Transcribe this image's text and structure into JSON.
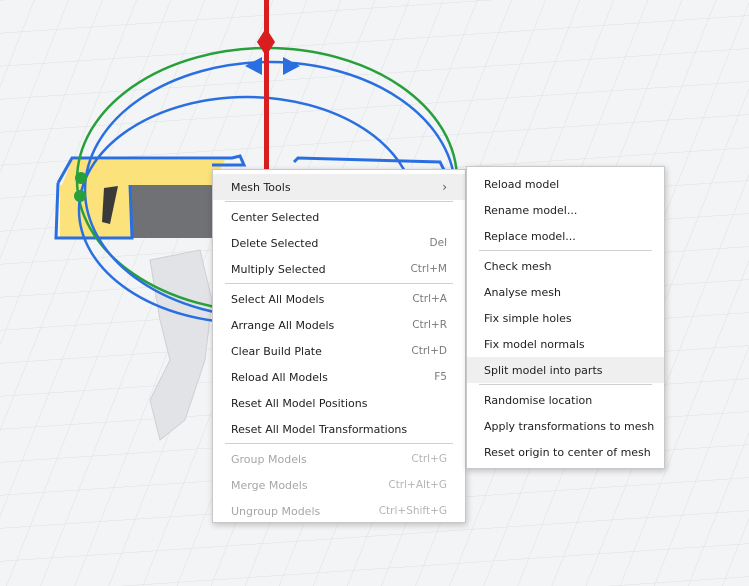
{
  "context_menu": {
    "groups": [
      [
        {
          "label": "Mesh Tools",
          "submenu": true,
          "hover": true
        }
      ],
      [
        {
          "label": "Center Selected",
          "shortcut": ""
        },
        {
          "label": "Delete Selected",
          "shortcut": "Del"
        },
        {
          "label": "Multiply Selected",
          "shortcut": "Ctrl+M"
        }
      ],
      [
        {
          "label": "Select All Models",
          "shortcut": "Ctrl+A"
        },
        {
          "label": "Arrange All Models",
          "shortcut": "Ctrl+R"
        },
        {
          "label": "Clear Build Plate",
          "shortcut": "Ctrl+D"
        },
        {
          "label": "Reload All Models",
          "shortcut": "F5"
        },
        {
          "label": "Reset All Model Positions",
          "shortcut": ""
        },
        {
          "label": "Reset All Model Transformations",
          "shortcut": ""
        }
      ],
      [
        {
          "label": "Group Models",
          "shortcut": "Ctrl+G",
          "disabled": true
        },
        {
          "label": "Merge Models",
          "shortcut": "Ctrl+Alt+G",
          "disabled": true
        },
        {
          "label": "Ungroup Models",
          "shortcut": "Ctrl+Shift+G",
          "disabled": true
        }
      ]
    ],
    "submenu_chevron": "›"
  },
  "mesh_tools_submenu": {
    "groups": [
      [
        {
          "label": "Reload model"
        },
        {
          "label": "Rename model..."
        },
        {
          "label": "Replace model..."
        }
      ],
      [
        {
          "label": "Check mesh"
        },
        {
          "label": "Analyse mesh"
        },
        {
          "label": "Fix simple holes"
        },
        {
          "label": "Fix model normals"
        },
        {
          "label": "Split model into parts",
          "hover": true
        }
      ],
      [
        {
          "label": "Randomise location"
        },
        {
          "label": "Apply transformations to mesh"
        },
        {
          "label": "Reset origin to center of mesh"
        }
      ]
    ]
  },
  "colors": {
    "viewport_bg": "#f3f4f6",
    "grid_line": "#dcdde0",
    "model_top": "#fbe27a",
    "model_side": "#6f7175",
    "selection_outline": "#2a6fe0",
    "rotate_ring_green": "#27a03b",
    "rotate_ring_blue": "#2a6fe0",
    "move_axis_red": "#d81e1e"
  }
}
